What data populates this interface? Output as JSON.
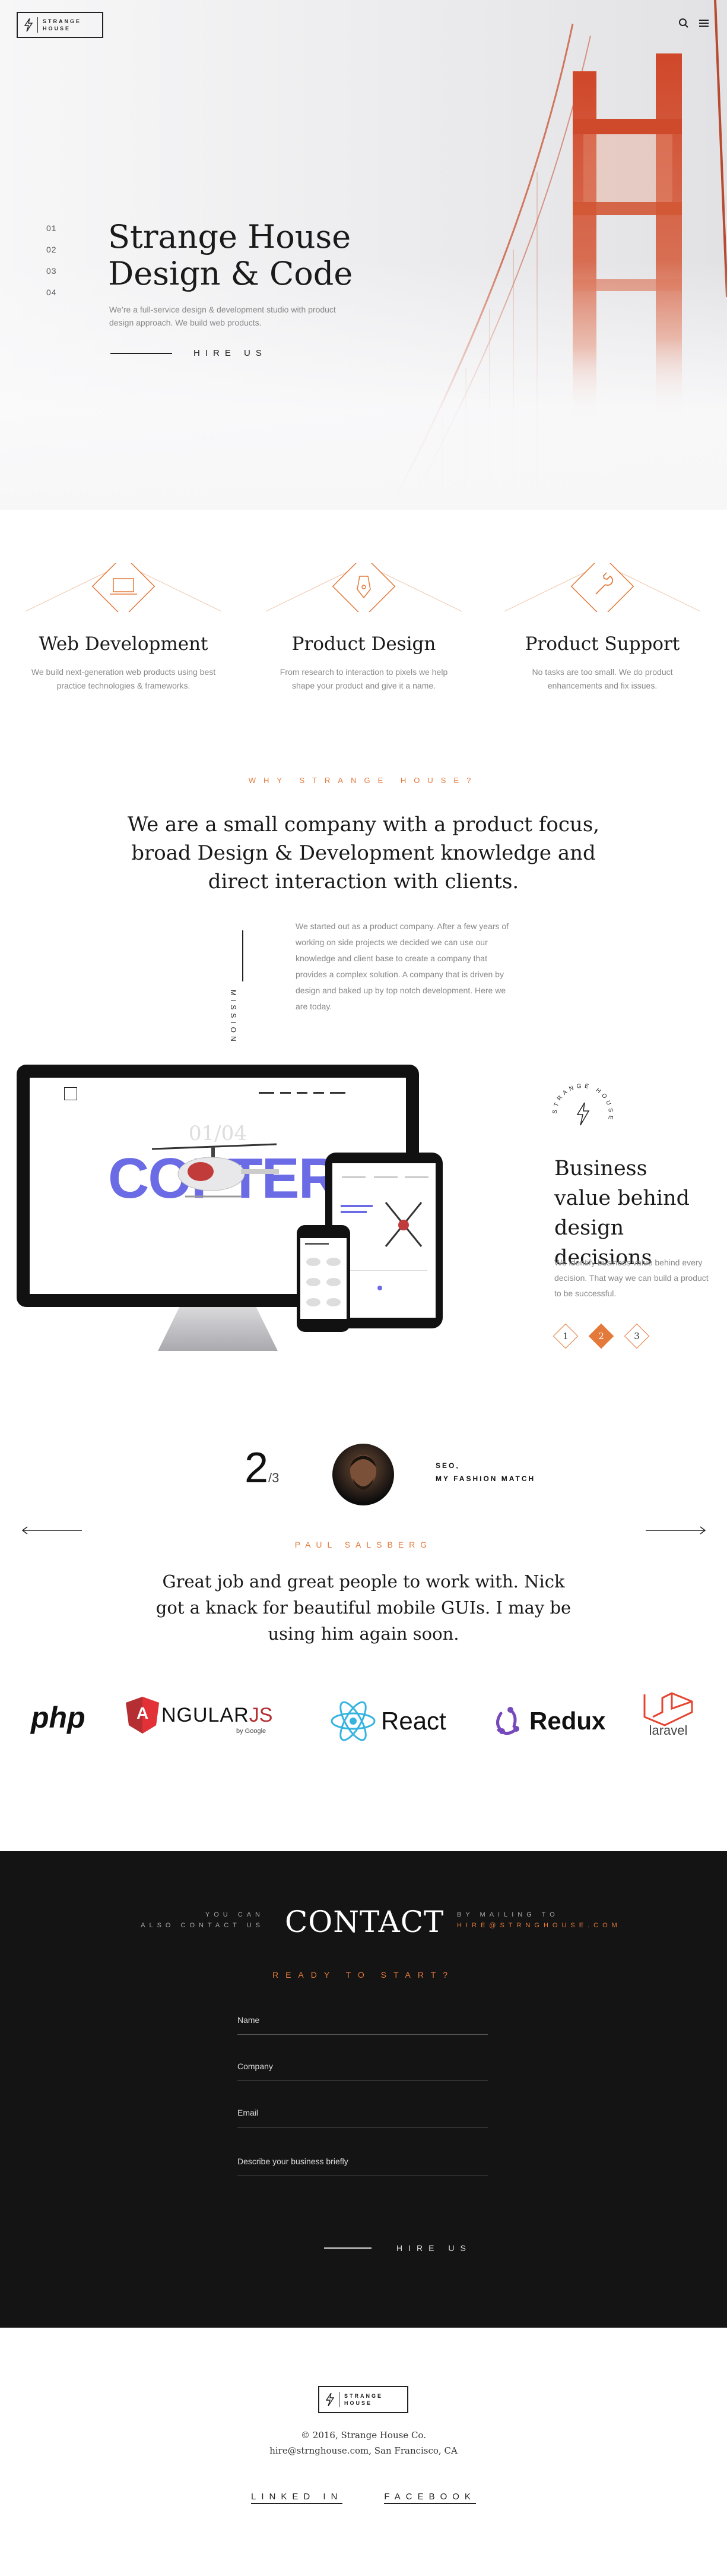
{
  "header": {
    "logo_text_line1": "STRANGE",
    "logo_text_line2": "HOUSE",
    "search_icon": "search-icon",
    "menu_icon": "hamburger-menu-icon"
  },
  "hero": {
    "slides": [
      "01",
      "02",
      "03",
      "04"
    ],
    "title_line1": "Strange House",
    "title_line2": "Design & Code",
    "lead": "We’re a full-service design & development studio with product design approach. We build web products.",
    "cta": "HIRE US"
  },
  "services": [
    {
      "icon": "laptop-icon",
      "title": "Web Development",
      "text": "We build next-generation web products using best practice technologies & frameworks."
    },
    {
      "icon": "pen-nib-icon",
      "title": "Product Design",
      "text": "From research to interaction to pixels we help shape your product and give it a name."
    },
    {
      "icon": "wrench-icon",
      "title": "Product Support",
      "text": "No tasks are too small. We do product enhancements and fix issues."
    }
  ],
  "why": {
    "eyebrow": "WHY STRANGE HOUSE?",
    "heading": "We are a small company with a product focus, broad Design & Development knowledge and direct interaction with clients.",
    "side_label": "MISSION",
    "body": "We started out as a product company. After a few years of working on side projects we decided we can use our knowledge and client base to create a company that provides a complex solution. A company that is driven by design and baked up by top notch development. Here we are today."
  },
  "showcase": {
    "screen_slide": "01/04",
    "screen_word": "COPTER",
    "heading": "Business value behind design decisions",
    "text": "We identify business value behind every decision. That way we can build a product to be successful.",
    "ring_text": "STRANGE HOUSE",
    "pages": [
      "1",
      "2",
      "3"
    ],
    "active_page": "2",
    "colors": {
      "accent": "#e37a3c",
      "copter_purple": "#6b6be6"
    }
  },
  "testimonial": {
    "index": "2",
    "total": "/3",
    "client_role": "SEO,",
    "client_company": "MY FASHION MATCH",
    "author": "PAUL SALSBERG",
    "quote": "Great job and great people to work with. Nick got a knack for beautiful mobile GUIs. I may be using him again soon.",
    "prev_icon": "arrow-left-icon",
    "next_icon": "arrow-right-icon"
  },
  "tech": {
    "php": "php",
    "angular_a": "A",
    "angular_rest": "NGULAR",
    "angular_js": "JS",
    "angular_sub": "by Google",
    "react": "React",
    "redux": "Redux",
    "laravel": "laravel"
  },
  "contact": {
    "left_line1": "YOU CAN",
    "left_line2": "ALSO CONTACT US",
    "title": "CONTACT",
    "right_line1": "BY MAILING TO",
    "right_email": "HIRE@STRNGHOUSE.COM",
    "ready": "READY TO START?",
    "fields": {
      "name": "Name",
      "company": "Company",
      "email": "Email",
      "brief": "Describe your business briefly"
    },
    "cta": "HIRE US"
  },
  "footer": {
    "logo_text_line1": "STRANGE",
    "logo_text_line2": "HOUSE",
    "copyright": "© 2016, Strange House Co.",
    "address": "hire@strnghouse.com, San Francisco, CA",
    "linkedin": "LINKED IN",
    "facebook": "FACEBOOK"
  }
}
